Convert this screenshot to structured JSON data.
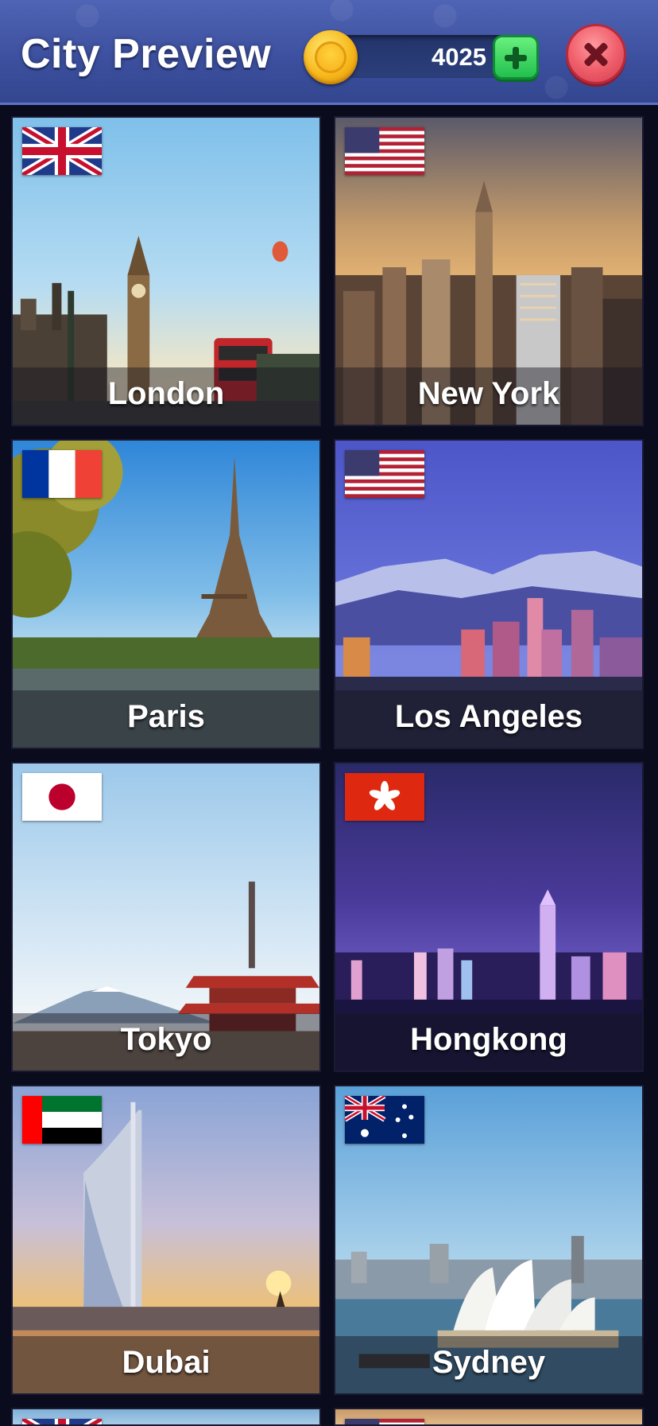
{
  "header": {
    "title": "City Preview",
    "coins": "4025",
    "coin_icon": "gold-coin-icon",
    "add_icon": "plus-icon",
    "close_icon": "close-icon"
  },
  "cities": [
    {
      "name": "London",
      "flag": "uk-flag-icon"
    },
    {
      "name": "New York",
      "flag": "us-flag-icon"
    },
    {
      "name": "Paris",
      "flag": "france-flag-icon"
    },
    {
      "name": "Los Angeles",
      "flag": "us-flag-icon"
    },
    {
      "name": "Tokyo",
      "flag": "japan-flag-icon"
    },
    {
      "name": "Hongkong",
      "flag": "hongkong-flag-icon"
    },
    {
      "name": "Dubai",
      "flag": "uae-flag-icon"
    },
    {
      "name": "Sydney",
      "flag": "australia-flag-icon"
    }
  ],
  "colors": {
    "header_bg": "#3c4f9e",
    "page_bg": "#0b0b1e",
    "plus_green": "#22c04e",
    "close_red": "#f0606c"
  }
}
